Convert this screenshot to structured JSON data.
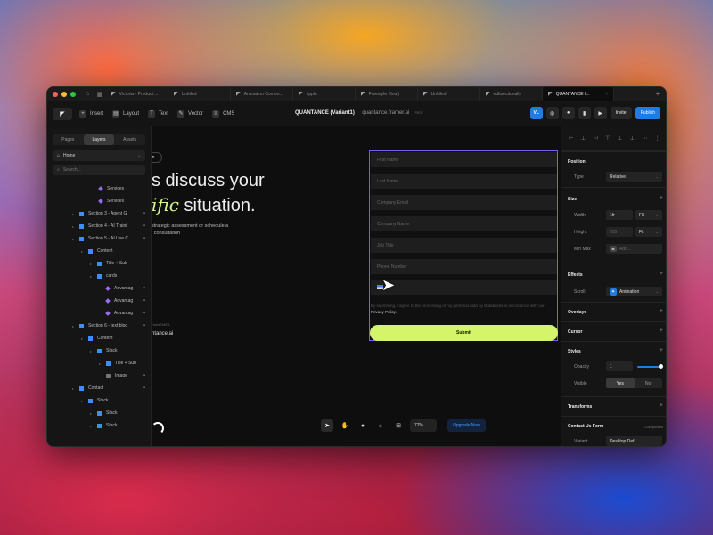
{
  "tabs": [
    {
      "icon": "framer-icon",
      "label": "Victoria - Product ..."
    },
    {
      "icon": "framer-icon",
      "label": "Untitled"
    },
    {
      "icon": "framer-icon",
      "label": "Animation Compo..."
    },
    {
      "icon": "framer-icon",
      "label": "ripple"
    },
    {
      "icon": "framer-icon",
      "label": "Freestyle (final)"
    },
    {
      "icon": "framer-icon",
      "label": "Untitled"
    },
    {
      "icon": "framer-icon",
      "label": "editsectionally"
    },
    {
      "icon": "framer-icon",
      "label": "QUANTANCE I...",
      "active": true
    }
  ],
  "toolbar": {
    "insert": "Insert",
    "layout": "Layout",
    "text": "Text",
    "vector": "Vector",
    "cms": "CMS",
    "project_name": "QUANTANCE (Variant1)",
    "project_url": "quantance.framer.ai",
    "plan": "FREE",
    "avatar": "VL",
    "invite": "Invite",
    "publish": "Publish"
  },
  "left_panel": {
    "tabs": [
      "Pages",
      "Layers",
      "Assets"
    ],
    "page": "Home",
    "search_placeholder": "Search...",
    "layers": [
      {
        "label": "Services",
        "type": "dia",
        "indent": 58,
        "caret": false
      },
      {
        "label": "Services",
        "type": "dia",
        "indent": 58,
        "caret": false
      },
      {
        "label": "Section 3 - Agent G",
        "type": "sq",
        "indent": 36,
        "caret": true,
        "home": true
      },
      {
        "label": "Section 4 - AI Traini",
        "type": "sq",
        "indent": 36,
        "caret": true,
        "home": true
      },
      {
        "label": "Section 5 - AI Use C",
        "type": "sq",
        "indent": 36,
        "caret": true,
        "home": true
      },
      {
        "label": "Content",
        "type": "sq",
        "indent": 46,
        "caret": true
      },
      {
        "label": "Title + Sub",
        "type": "sq",
        "indent": 56,
        "caret": true
      },
      {
        "label": "cards",
        "type": "sq",
        "indent": 56,
        "caret": true
      },
      {
        "label": "Advantag",
        "type": "dia",
        "indent": 66,
        "caret": false,
        "home": true
      },
      {
        "label": "Advantag",
        "type": "dia",
        "indent": 66,
        "caret": false,
        "home": true
      },
      {
        "label": "Advantag",
        "type": "dia",
        "indent": 66,
        "caret": false,
        "home": true
      },
      {
        "label": "Section 6 - text bloc",
        "type": "sq",
        "indent": 36,
        "caret": true,
        "home": true
      },
      {
        "label": "Content",
        "type": "sq",
        "indent": 46,
        "caret": true
      },
      {
        "label": "Stack",
        "type": "sq",
        "indent": 56,
        "caret": true
      },
      {
        "label": "Title + Sub",
        "type": "sq",
        "indent": 66,
        "caret": true
      },
      {
        "label": "Image",
        "type": "img",
        "indent": 66,
        "caret": false,
        "home": true
      },
      {
        "label": "Contact",
        "type": "sq",
        "indent": 36,
        "caret": true,
        "home": true
      },
      {
        "label": "Stack",
        "type": "sq",
        "indent": 46,
        "caret": true
      },
      {
        "label": "Stack",
        "type": "sq",
        "indent": 56,
        "caret": true
      },
      {
        "label": "Stack",
        "type": "sq",
        "indent": 56,
        "caret": true
      }
    ]
  },
  "canvas": {
    "frame_tag": "n",
    "hero_line1": "s discuss your",
    "hero_line2_italic": "ific",
    "hero_line2_rest": " situation.",
    "hero_sub_line1": "strategic assessment or schedule a",
    "hero_sub_line2": "l consultation",
    "left_mini": "HumiEMEA",
    "left_url": "ntance.ai",
    "form_fields": [
      "First Name",
      "Last Name",
      "Company Email",
      "Company Name",
      "Job Title",
      "Phone Number"
    ],
    "country_field": "E",
    "consent_text": "By submitting, I agree to the processing of my personal data by Databricks in accordance with our ",
    "consent_link": "Privacy Policy.",
    "submit": "Submit",
    "zoom": "77%",
    "upgrade": "Upgrade Now"
  },
  "right_panel": {
    "position": {
      "title": "Position",
      "type_label": "Type",
      "type_value": "Relative"
    },
    "size": {
      "title": "Size",
      "width_label": "Width",
      "width_value": "1fr",
      "width_mode": "Fill",
      "height_label": "Height",
      "height_value": "555",
      "height_mode": "Fit",
      "minmax_label": "Min Max",
      "minmax_value": "Add..."
    },
    "effects": {
      "title": "Effects",
      "scroll_label": "Scroll",
      "scroll_value": "Animation"
    },
    "overlays": "Overlays",
    "cursor": "Cursor",
    "styles": {
      "title": "Styles",
      "opacity_label": "Opacity",
      "opacity_value": "1",
      "opacity_level": 1,
      "visible_label": "Visible",
      "visible_yes": "Yes",
      "visible_no": "No"
    },
    "transforms": "Transforms",
    "component": {
      "title": "Contact Us Form",
      "tag": "Component",
      "variant_label": "Variant",
      "variant_value": "Desktop Def"
    }
  },
  "colors": {
    "accent": "#1e7ce6",
    "lime": "#d4f56a",
    "selection": "#7a5ef0"
  }
}
